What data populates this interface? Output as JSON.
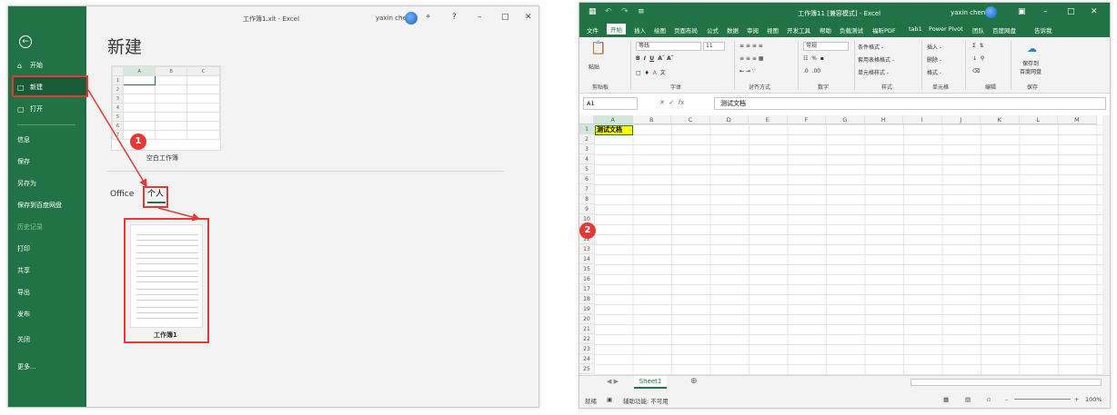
{
  "left_window": {
    "title": "工作簿1.xlt  -  Excel",
    "user": "yaxin chen",
    "help": "?",
    "heading": "新建",
    "sidebar": {
      "back": "←",
      "items": [
        {
          "icon": "⌂",
          "label": "开始"
        },
        {
          "icon": "□",
          "label": "新建"
        },
        {
          "icon": "▢",
          "label": "打开"
        },
        {
          "label": "信息"
        },
        {
          "label": "保存"
        },
        {
          "label": "另存为"
        },
        {
          "label": "保存到百度网盘"
        },
        {
          "label": "历史记录"
        },
        {
          "label": "打印"
        },
        {
          "label": "共享"
        },
        {
          "label": "导出"
        },
        {
          "label": "发布"
        },
        {
          "label": "关闭"
        },
        {
          "label": "更多..."
        }
      ]
    },
    "blank_template": {
      "caption": "空白工作簿",
      "columns": [
        "",
        "A",
        "B",
        "C"
      ],
      "rows": [
        "1",
        "2",
        "3",
        "4",
        "5",
        "6",
        "7"
      ]
    },
    "tabs": {
      "office": "Office",
      "personal": "个人"
    },
    "personal_template": {
      "caption": "工作簿1"
    },
    "badge1": "1"
  },
  "right_window": {
    "title": "工作簿11  [兼容模式]  -  Excel",
    "user": "yaxin chen",
    "menu": [
      "文件",
      "开始",
      "插入",
      "绘图",
      "页面布局",
      "公式",
      "数据",
      "审阅",
      "视图",
      "开发工具",
      "帮助",
      "负载测试",
      "福昕PDF",
      "tab1",
      "Power Pivot",
      "团队",
      "百度网盘",
      "告诉我"
    ],
    "ribbon": {
      "paste": "粘贴",
      "font_name": "等线",
      "font_size": "11",
      "number_format": "常规",
      "cond_format": "条件格式 -",
      "table_format": "套用表格格式 -",
      "cell_style": "单元格样式 -",
      "insert": "插入 -",
      "delete": "删除 -",
      "format": "格式 -",
      "save_baidu": "保存到\n百度网盘",
      "groups": [
        "剪贴板",
        "字体",
        "对齐方式",
        "数字",
        "样式",
        "单元格",
        "编辑",
        "保存"
      ]
    },
    "name_box": "A1",
    "formula_value": "测试文档",
    "columns": [
      "A",
      "B",
      "C",
      "D",
      "E",
      "F",
      "G",
      "H",
      "I",
      "J",
      "K",
      "L",
      "M"
    ],
    "rows": [
      "1",
      "2",
      "3",
      "4",
      "5",
      "6",
      "7",
      "8",
      "9",
      "10",
      "11",
      "12",
      "13",
      "14",
      "15",
      "16",
      "17",
      "18",
      "19",
      "20",
      "21",
      "22",
      "23",
      "24",
      "25"
    ],
    "cell_a1": "测试文档",
    "sheet_tab": "Sheet1",
    "status_ready": "就绪",
    "status_accessibility": "辅助功能: 不可用",
    "zoom": "100%",
    "badge2": "2"
  }
}
